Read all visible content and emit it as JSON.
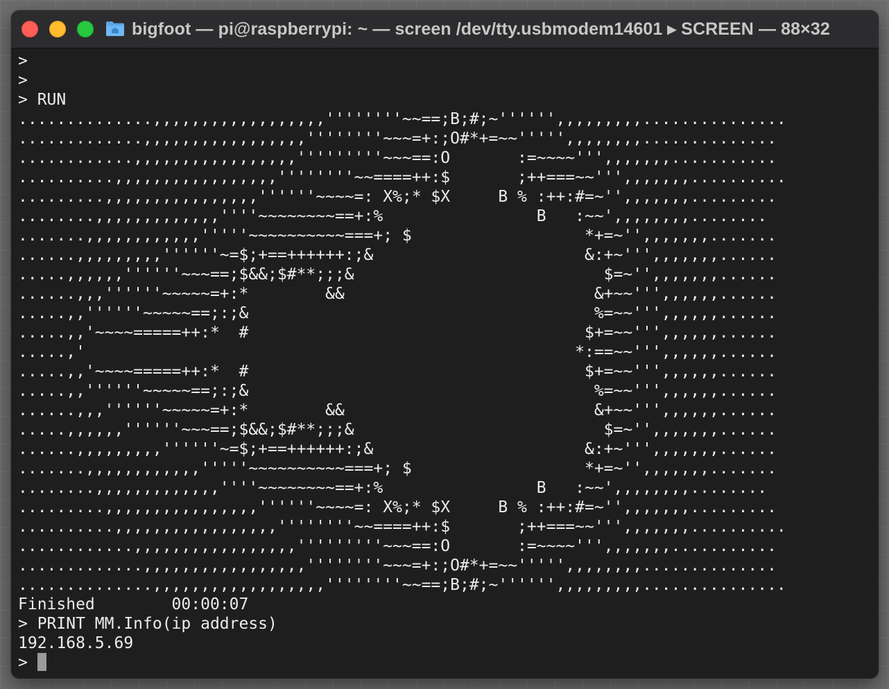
{
  "window": {
    "title": "bigfoot — pi@raspberrypi: ~ — screen /dev/tty.usbmodem14601 ▸ SCREEN — 88×32"
  },
  "terminal": {
    "lines": [
      ">",
      ">",
      "> RUN",
      "..............,,,,,,,,,,,,,,,,,,''''''''~~==;B;#;~'''''',,,,,,,,,...............",
      ".............,,,,,,,,,,,,,,,,,''''''''~~~=+:;O#*+=~~''''',,,,,,,,..............",
      "............,,,,,,,,,,,,,,,,,'''''''''~~~==:O       :=~~~~''',,,,,,,...........",
      "..........,,,,,,,,,,,,,,,,,''''''''~~====++:$       ;++===~~''',,,,,,,..........",
      ".........,,,,,,,,,,,,,,,,''''''~~~~=: X%;* $X     B % :++:#=~'',,,,,,,.........",
      "........,,,,,,,,,,,,,''''~~~~~~~~==+:%                B   :~~',,,,,,,,........",
      ".......,,,,,,,,,,,,'''''~~~~~~~~~~===+; $                  *+=~'',,,,,,,.......",
      "......,,,,,,,,,''''''~=$;+==++++++:;&                      &:+~''',,,,,,,......",
      ".....,,,,,,''''''~~~==;$&&;$#**;;;&                          $=~'',,,,,,,......",
      "......,,,''''''~~~~~=+:*        &&                          &+~~''',,,,,,......",
      ".....,,''''''~~~~~==;:;&                                    %=~~''',,,,,,......",
      ".....,,'~~~~=====++:*  #                                   $+=~~''',,,,,,......",
      ".....,'                                                   *:==~~''',,,,,,......",
      ".....,,'~~~~=====++:*  #                                   $+=~~''',,,,,,......",
      ".....,,''''''~~~~~==;:;&                                    %=~~''',,,,,,......",
      "......,,,''''''~~~~~=+:*        &&                          &+~~''',,,,,,......",
      ".....,,,,,,''''''~~~==;$&&;$#**;;;&                          $=~'',,,,,,,......",
      "......,,,,,,,,,''''''~=$;+==++++++:;&                      &:+~''',,,,,,,......",
      ".......,,,,,,,,,,,,'''''~~~~~~~~~~===+; $                  *+=~'',,,,,,,.......",
      "........,,,,,,,,,,,,,''''~~~~~~~~==+:%                B   :~~',,,,,,,,........",
      ".........,,,,,,,,,,,,,,,,''''''~~~~=: X%;* $X     B % :++:#=~'',,,,,,,.........",
      "..........,,,,,,,,,,,,,,,,,''''''''~~====++:$       ;++===~~''',,,,,,,..........",
      "............,,,,,,,,,,,,,,,,,'''''''''~~~==:O       :=~~~~''',,,,,,,...........",
      ".............,,,,,,,,,,,,,,,,,''''''''~~~=+:;O#*+=~~''''',,,,,,,,..............",
      "..............,,,,,,,,,,,,,,,,,,''''''''~~==;B;#;~'''''',,,,,,,,,...............",
      "Finished        00:00:07",
      "> PRINT MM.Info(ip address)",
      "192.168.5.69"
    ],
    "prompt": "> "
  }
}
